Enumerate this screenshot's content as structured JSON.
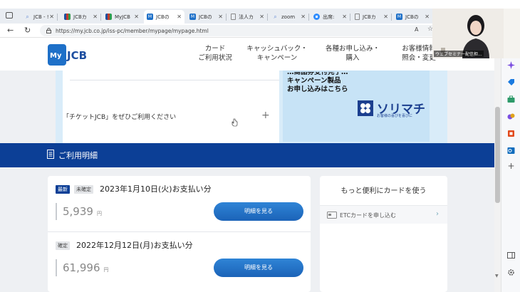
{
  "browser": {
    "tabs": [
      {
        "label": "JCB - !",
        "icon_color": "#6a8fd6",
        "icon": "search-icon"
      },
      {
        "label": "JCBカ",
        "icon_color": "#c23b2a",
        "icon": "jcb-icon"
      },
      {
        "label": "MyJCB",
        "icon_color": "#c23b2a",
        "icon": "jcb-icon"
      },
      {
        "label": "JCBの",
        "icon_color": "#1e70c8",
        "icon": "myjcb-icon"
      },
      {
        "label": "JCBの",
        "icon_color": "#1e70c8",
        "icon": "myjcb-icon"
      },
      {
        "label": "法人カ",
        "icon_color": "#888888",
        "icon": "page-icon"
      },
      {
        "label": "zoom",
        "icon_color": "#6a8fd6",
        "icon": "search-icon"
      },
      {
        "label": "出席:",
        "icon_color": "#2d8cff",
        "icon": "zoom-icon"
      },
      {
        "label": "JCBカ",
        "icon_color": "#888888",
        "icon": "page-icon"
      },
      {
        "label": "JCBの",
        "icon_color": "#1e70c8",
        "icon": "myjcb-icon"
      }
    ],
    "url": "https://my.jcb.co.jp/iss-pc/member/mypage/mypage.html",
    "reader_label": "A"
  },
  "header": {
    "logo_my": "My",
    "logo_jcb": "JCB",
    "nav": [
      {
        "line1": "カード",
        "line2": "ご利用状況"
      },
      {
        "line1": "キャッシュバック・",
        "line2": "キャンペーン"
      },
      {
        "line1": "各種お申し込み・",
        "line2": "購入"
      },
      {
        "line1": "お客様情報",
        "line2": "照会・変更"
      }
    ]
  },
  "promo": {
    "ticket_text": "「チケットJCB」をぜひご利用ください",
    "plus": "+",
    "banner_line1": "…商品券受付完了…",
    "banner_line2": "キャンペーン製品",
    "banner_line3": "お申し込みはこちら",
    "banner_brand": "ソリマチ",
    "banner_tag": "お客様の喜びを喜びに"
  },
  "section": {
    "title": "ご利用明細"
  },
  "payments": [
    {
      "badges": [
        "最新",
        "未確定"
      ],
      "title": "2023年1月10日(火)お支払い分",
      "amount": "5,939",
      "yen": "円",
      "button": "明細を見る"
    },
    {
      "badges": [
        "確定"
      ],
      "title": "2022年12月12日(月)お支払い分",
      "amount": "61,996",
      "yen": "円",
      "button": "明細を見る"
    }
  ],
  "side": {
    "title": "もっと便利にカードを使う",
    "etc_label": "ETCカードを申し込む"
  },
  "video": {
    "name": "ウェブセミナー配信担..."
  },
  "colors": {
    "jcb_blue": "#0c3f96",
    "button_blue": "#1b63b8",
    "promo_bg": "#d9ecf9"
  }
}
